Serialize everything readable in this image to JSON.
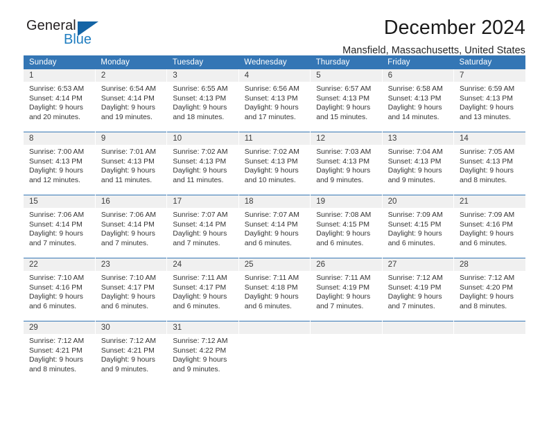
{
  "brand": {
    "name_top": "General",
    "name_bottom": "Blue",
    "triangle_color": "#1464a5",
    "blue_color": "#1f7dc0"
  },
  "header": {
    "title": "December 2024",
    "subtitle": "Mansfield, Massachusetts, United States"
  },
  "theme": {
    "header_row_bg": "#3476b5",
    "daynum_bg": "#f0f0f0",
    "grid_line": "#3476b5"
  },
  "weekday_headers": [
    "Sunday",
    "Monday",
    "Tuesday",
    "Wednesday",
    "Thursday",
    "Friday",
    "Saturday"
  ],
  "weeks": [
    [
      {
        "day": "1",
        "sunrise": "Sunrise: 6:53 AM",
        "sunset": "Sunset: 4:14 PM",
        "daylight1": "Daylight: 9 hours",
        "daylight2": "and 20 minutes."
      },
      {
        "day": "2",
        "sunrise": "Sunrise: 6:54 AM",
        "sunset": "Sunset: 4:14 PM",
        "daylight1": "Daylight: 9 hours",
        "daylight2": "and 19 minutes."
      },
      {
        "day": "3",
        "sunrise": "Sunrise: 6:55 AM",
        "sunset": "Sunset: 4:13 PM",
        "daylight1": "Daylight: 9 hours",
        "daylight2": "and 18 minutes."
      },
      {
        "day": "4",
        "sunrise": "Sunrise: 6:56 AM",
        "sunset": "Sunset: 4:13 PM",
        "daylight1": "Daylight: 9 hours",
        "daylight2": "and 17 minutes."
      },
      {
        "day": "5",
        "sunrise": "Sunrise: 6:57 AM",
        "sunset": "Sunset: 4:13 PM",
        "daylight1": "Daylight: 9 hours",
        "daylight2": "and 15 minutes."
      },
      {
        "day": "6",
        "sunrise": "Sunrise: 6:58 AM",
        "sunset": "Sunset: 4:13 PM",
        "daylight1": "Daylight: 9 hours",
        "daylight2": "and 14 minutes."
      },
      {
        "day": "7",
        "sunrise": "Sunrise: 6:59 AM",
        "sunset": "Sunset: 4:13 PM",
        "daylight1": "Daylight: 9 hours",
        "daylight2": "and 13 minutes."
      }
    ],
    [
      {
        "day": "8",
        "sunrise": "Sunrise: 7:00 AM",
        "sunset": "Sunset: 4:13 PM",
        "daylight1": "Daylight: 9 hours",
        "daylight2": "and 12 minutes."
      },
      {
        "day": "9",
        "sunrise": "Sunrise: 7:01 AM",
        "sunset": "Sunset: 4:13 PM",
        "daylight1": "Daylight: 9 hours",
        "daylight2": "and 11 minutes."
      },
      {
        "day": "10",
        "sunrise": "Sunrise: 7:02 AM",
        "sunset": "Sunset: 4:13 PM",
        "daylight1": "Daylight: 9 hours",
        "daylight2": "and 11 minutes."
      },
      {
        "day": "11",
        "sunrise": "Sunrise: 7:02 AM",
        "sunset": "Sunset: 4:13 PM",
        "daylight1": "Daylight: 9 hours",
        "daylight2": "and 10 minutes."
      },
      {
        "day": "12",
        "sunrise": "Sunrise: 7:03 AM",
        "sunset": "Sunset: 4:13 PM",
        "daylight1": "Daylight: 9 hours",
        "daylight2": "and 9 minutes."
      },
      {
        "day": "13",
        "sunrise": "Sunrise: 7:04 AM",
        "sunset": "Sunset: 4:13 PM",
        "daylight1": "Daylight: 9 hours",
        "daylight2": "and 9 minutes."
      },
      {
        "day": "14",
        "sunrise": "Sunrise: 7:05 AM",
        "sunset": "Sunset: 4:13 PM",
        "daylight1": "Daylight: 9 hours",
        "daylight2": "and 8 minutes."
      }
    ],
    [
      {
        "day": "15",
        "sunrise": "Sunrise: 7:06 AM",
        "sunset": "Sunset: 4:14 PM",
        "daylight1": "Daylight: 9 hours",
        "daylight2": "and 7 minutes."
      },
      {
        "day": "16",
        "sunrise": "Sunrise: 7:06 AM",
        "sunset": "Sunset: 4:14 PM",
        "daylight1": "Daylight: 9 hours",
        "daylight2": "and 7 minutes."
      },
      {
        "day": "17",
        "sunrise": "Sunrise: 7:07 AM",
        "sunset": "Sunset: 4:14 PM",
        "daylight1": "Daylight: 9 hours",
        "daylight2": "and 7 minutes."
      },
      {
        "day": "18",
        "sunrise": "Sunrise: 7:07 AM",
        "sunset": "Sunset: 4:14 PM",
        "daylight1": "Daylight: 9 hours",
        "daylight2": "and 6 minutes."
      },
      {
        "day": "19",
        "sunrise": "Sunrise: 7:08 AM",
        "sunset": "Sunset: 4:15 PM",
        "daylight1": "Daylight: 9 hours",
        "daylight2": "and 6 minutes."
      },
      {
        "day": "20",
        "sunrise": "Sunrise: 7:09 AM",
        "sunset": "Sunset: 4:15 PM",
        "daylight1": "Daylight: 9 hours",
        "daylight2": "and 6 minutes."
      },
      {
        "day": "21",
        "sunrise": "Sunrise: 7:09 AM",
        "sunset": "Sunset: 4:16 PM",
        "daylight1": "Daylight: 9 hours",
        "daylight2": "and 6 minutes."
      }
    ],
    [
      {
        "day": "22",
        "sunrise": "Sunrise: 7:10 AM",
        "sunset": "Sunset: 4:16 PM",
        "daylight1": "Daylight: 9 hours",
        "daylight2": "and 6 minutes."
      },
      {
        "day": "23",
        "sunrise": "Sunrise: 7:10 AM",
        "sunset": "Sunset: 4:17 PM",
        "daylight1": "Daylight: 9 hours",
        "daylight2": "and 6 minutes."
      },
      {
        "day": "24",
        "sunrise": "Sunrise: 7:11 AM",
        "sunset": "Sunset: 4:17 PM",
        "daylight1": "Daylight: 9 hours",
        "daylight2": "and 6 minutes."
      },
      {
        "day": "25",
        "sunrise": "Sunrise: 7:11 AM",
        "sunset": "Sunset: 4:18 PM",
        "daylight1": "Daylight: 9 hours",
        "daylight2": "and 6 minutes."
      },
      {
        "day": "26",
        "sunrise": "Sunrise: 7:11 AM",
        "sunset": "Sunset: 4:19 PM",
        "daylight1": "Daylight: 9 hours",
        "daylight2": "and 7 minutes."
      },
      {
        "day": "27",
        "sunrise": "Sunrise: 7:12 AM",
        "sunset": "Sunset: 4:19 PM",
        "daylight1": "Daylight: 9 hours",
        "daylight2": "and 7 minutes."
      },
      {
        "day": "28",
        "sunrise": "Sunrise: 7:12 AM",
        "sunset": "Sunset: 4:20 PM",
        "daylight1": "Daylight: 9 hours",
        "daylight2": "and 8 minutes."
      }
    ],
    [
      {
        "day": "29",
        "sunrise": "Sunrise: 7:12 AM",
        "sunset": "Sunset: 4:21 PM",
        "daylight1": "Daylight: 9 hours",
        "daylight2": "and 8 minutes."
      },
      {
        "day": "30",
        "sunrise": "Sunrise: 7:12 AM",
        "sunset": "Sunset: 4:21 PM",
        "daylight1": "Daylight: 9 hours",
        "daylight2": "and 9 minutes."
      },
      {
        "day": "31",
        "sunrise": "Sunrise: 7:12 AM",
        "sunset": "Sunset: 4:22 PM",
        "daylight1": "Daylight: 9 hours",
        "daylight2": "and 9 minutes."
      },
      {
        "day": "",
        "sunrise": "",
        "sunset": "",
        "daylight1": "",
        "daylight2": ""
      },
      {
        "day": "",
        "sunrise": "",
        "sunset": "",
        "daylight1": "",
        "daylight2": ""
      },
      {
        "day": "",
        "sunrise": "",
        "sunset": "",
        "daylight1": "",
        "daylight2": ""
      },
      {
        "day": "",
        "sunrise": "",
        "sunset": "",
        "daylight1": "",
        "daylight2": ""
      }
    ]
  ]
}
